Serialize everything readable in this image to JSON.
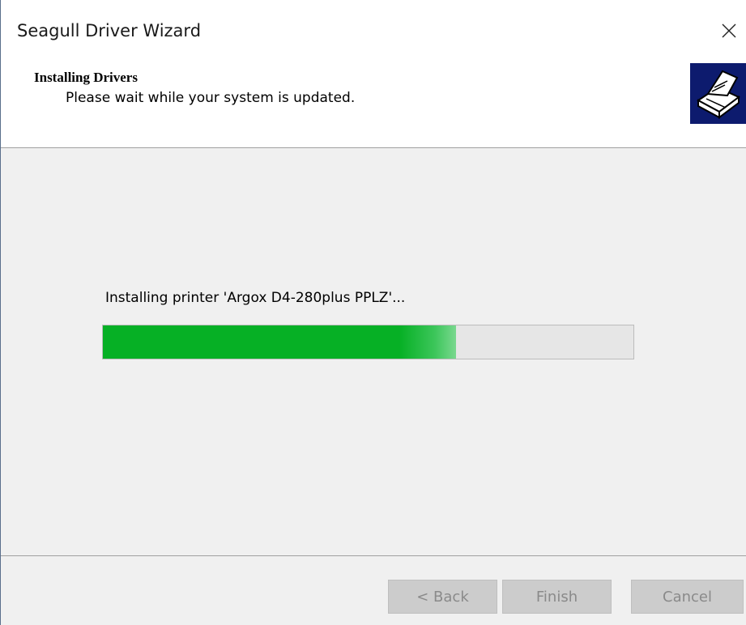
{
  "window": {
    "title": "Seagull Driver Wizard"
  },
  "header": {
    "title": "Installing Drivers",
    "subtitle": "Please wait while your system is updated.",
    "logo_icon": "printer-icon"
  },
  "body": {
    "status_text": "Installing printer 'Argox D4-280plus PPLZ'...",
    "progress_fraction": 0.665,
    "progress_color": "#06b025"
  },
  "buttons": {
    "back": "< Back",
    "finish": "Finish",
    "cancel": "Cancel"
  },
  "colors": {
    "logo_background": "#0d1b6e",
    "dialog_background": "#f0f0f0",
    "disabled_button": "#cccccc"
  }
}
